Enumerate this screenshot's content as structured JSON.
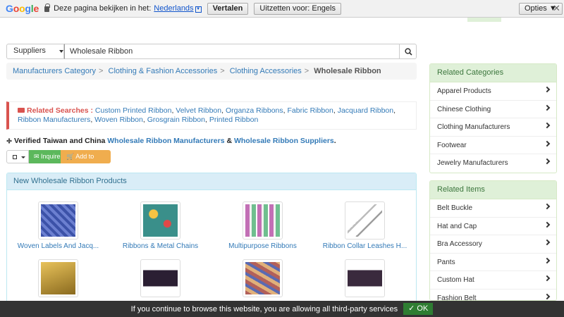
{
  "translate_bar": {
    "logo": [
      "G",
      "o",
      "o",
      "g",
      "l",
      "e"
    ],
    "prompt": "Deze pagina bekijken in het:",
    "language": "Nederlands",
    "translate_button": "Vertalen",
    "turn_off_button": "Uitzetten voor: Engels",
    "options_button": "Opties ▼",
    "close": "✕"
  },
  "search": {
    "type": "Suppliers",
    "query": "Wholesale Ribbon"
  },
  "breadcrumb": {
    "items": [
      "Manufacturers Category",
      "Clothing & Fashion Accessories",
      "Clothing Accessories"
    ],
    "current": "Wholesale Ribbon"
  },
  "related_searches": {
    "label": "Related Searches :",
    "links": [
      "Custom Printed Ribbon",
      "Velvet Ribbon",
      "Organza Ribbons",
      "Fabric Ribbon",
      "Jacquard Ribbon",
      "Ribbon Manufacturers",
      "Woven Ribbon",
      "Grosgrain Ribbon",
      "Printed Ribbon"
    ]
  },
  "verified": {
    "prefix": "Verified Taiwan and China",
    "link1": "Wholesale Ribbon Manufacturers",
    "amp": "&",
    "link2": "Wholesale Ribbon Suppliers",
    "suffix": "."
  },
  "actions": {
    "inquire": "Inquire",
    "add_to_basket": "Add to Basket"
  },
  "products": {
    "title": "New Wholesale Ribbon Products",
    "items": [
      {
        "name": "Woven Labels And Jacq...",
        "color": "#4a5fb5"
      },
      {
        "name": "Ribbons & Metal Chains",
        "color": "#2e8f8a"
      },
      {
        "name": "Multipurpose Ribbons",
        "color": "#c26fb5"
      },
      {
        "name": "Ribbon Collar Leashes H...",
        "color": "#bdbdbd"
      },
      {
        "name": "",
        "color": "#c9a23a"
      },
      {
        "name": "",
        "color": "#2b1f33"
      },
      {
        "name": "",
        "color": "#b2605a"
      },
      {
        "name": "",
        "color": "#3a2a3d"
      }
    ]
  },
  "related_categories": {
    "title": "Related Categories",
    "items": [
      "Apparel Products",
      "Chinese Clothing",
      "Clothing Manufacturers",
      "Footwear",
      "Jewelry Manufacturers"
    ]
  },
  "related_items": {
    "title": "Related Items",
    "items": [
      "Belt Buckle",
      "Hat and Cap",
      "Bra Accessory",
      "Pants",
      "Custom Hat",
      "Fashion Belt"
    ]
  },
  "cookie": {
    "message": "If you continue to browse this website, you are allowing all third-party services",
    "ok": "✓ OK"
  }
}
